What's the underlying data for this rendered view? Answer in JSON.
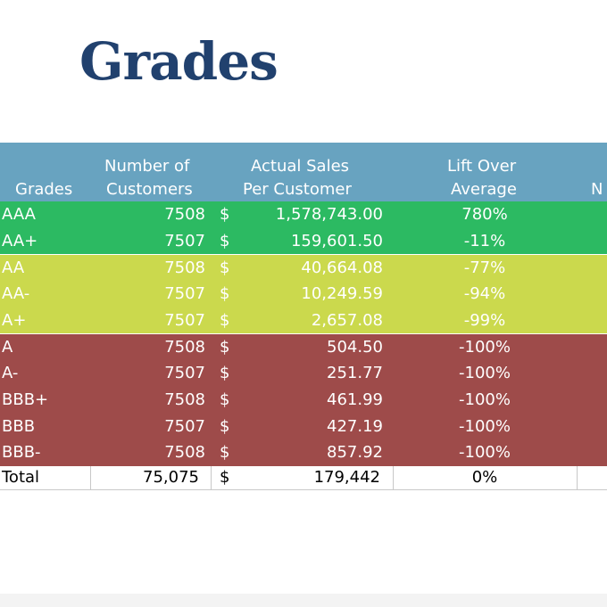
{
  "title": "Grades",
  "headers": {
    "grades": "Grades",
    "customers_line1": "Number of",
    "customers_line2": "Customers",
    "sales_line1": "Actual Sales",
    "sales_line2": "Per Customer",
    "lift_line1": "Lift Over",
    "lift_line2": "Average",
    "next_partial": "N"
  },
  "colors": {
    "header": "#68a3c0",
    "green": "#2cba62",
    "lime": "#cbd94d",
    "red": "#9e4b4a",
    "title": "#21416e"
  },
  "rows": [
    {
      "grade": "AAA",
      "customers": "7508",
      "dollar": "$",
      "sales": "1,578,743.00",
      "lift": "780%"
    },
    {
      "grade": "AA+",
      "customers": "7507",
      "dollar": "$",
      "sales": "159,601.50",
      "lift": "-11%"
    },
    {
      "grade": "AA",
      "customers": "7508",
      "dollar": "$",
      "sales": "40,664.08",
      "lift": "-77%"
    },
    {
      "grade": "AA-",
      "customers": "7507",
      "dollar": "$",
      "sales": "10,249.59",
      "lift": "-94%"
    },
    {
      "grade": "A+",
      "customers": "7507",
      "dollar": "$",
      "sales": "2,657.08",
      "lift": "-99%"
    },
    {
      "grade": "A",
      "customers": "7508",
      "dollar": "$",
      "sales": "504.50",
      "lift": "-100%"
    },
    {
      "grade": "A-",
      "customers": "7507",
      "dollar": "$",
      "sales": "251.77",
      "lift": "-100%"
    },
    {
      "grade": "BBB+",
      "customers": "7508",
      "dollar": "$",
      "sales": "461.99",
      "lift": "-100%"
    },
    {
      "grade": "BBB",
      "customers": "7507",
      "dollar": "$",
      "sales": "427.19",
      "lift": "-100%"
    },
    {
      "grade": "BBB-",
      "customers": "7508",
      "dollar": "$",
      "sales": "857.92",
      "lift": "-100%"
    }
  ],
  "total": {
    "label": "Total",
    "customers": "75,075",
    "dollar": "$",
    "sales": "179,442",
    "lift": "0%"
  }
}
